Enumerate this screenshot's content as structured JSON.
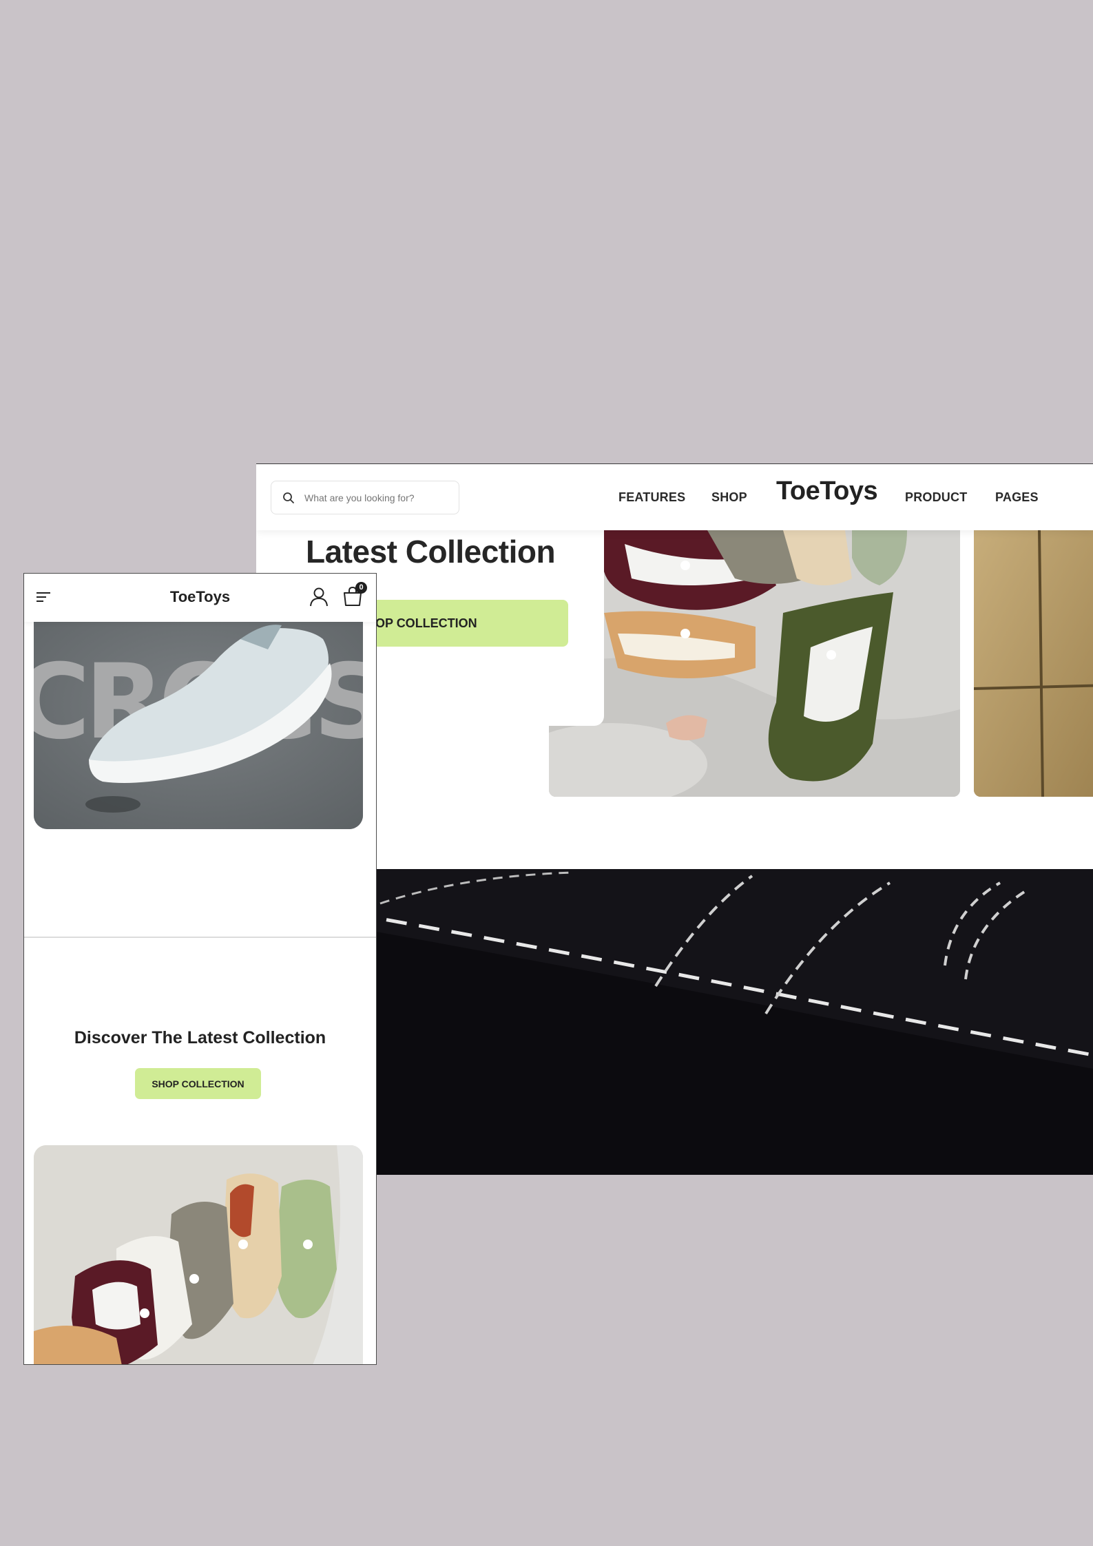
{
  "desktop": {
    "search": {
      "placeholder": "What are you looking for?"
    },
    "nav": {
      "features": "FEATURES",
      "shop": "SHOP",
      "logo": "ToeToys",
      "product": "PRODUCT",
      "pages": "PAGES"
    },
    "hero": {
      "title": "Latest Collection",
      "button": "SHOP COLLECTION"
    }
  },
  "mobile": {
    "header": {
      "logo": "ToeToys",
      "cart_count": "0"
    },
    "card_text": "CROCS",
    "section": {
      "title": "Discover The Latest Collection",
      "button": "SHOP COLLECTION"
    }
  },
  "colors": {
    "background": "#c9c3c8",
    "accent": "#d0ec95",
    "text": "#222222",
    "dark_banner": "#121116"
  },
  "icons": [
    "search-icon",
    "menu-icon",
    "user-icon",
    "cart-icon"
  ]
}
